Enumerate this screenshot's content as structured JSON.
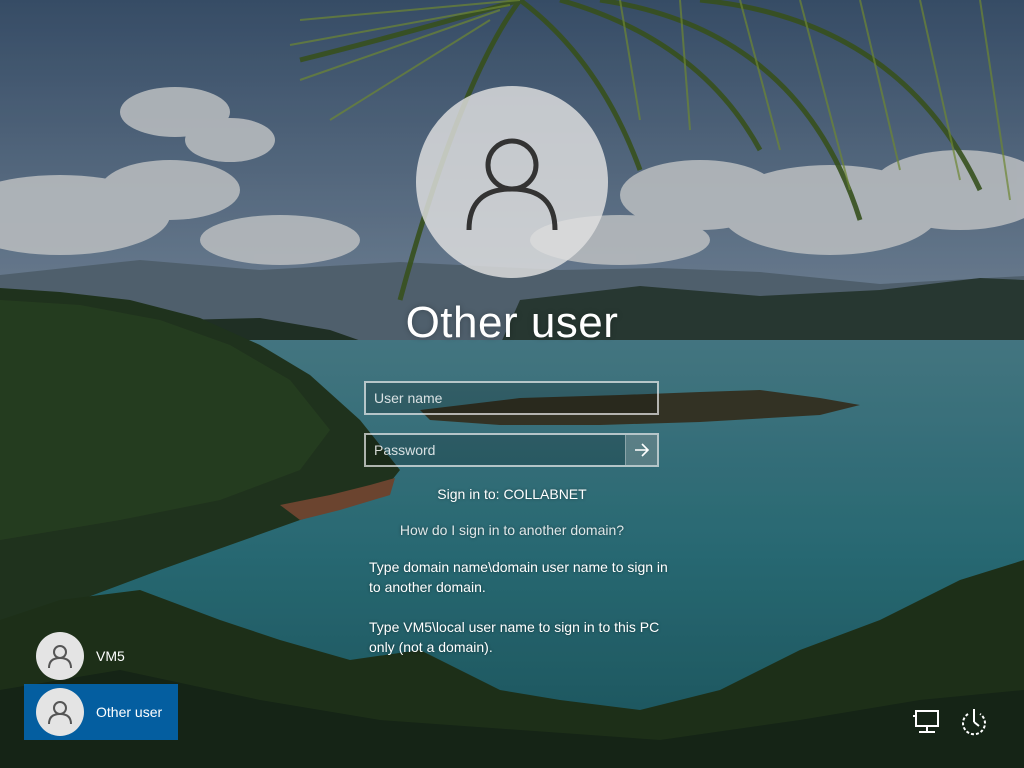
{
  "login": {
    "title": "Other user",
    "username_placeholder": "User name",
    "password_placeholder": "Password",
    "sign_in_to": "Sign in to: COLLABNET",
    "domain_help_link": "How do I sign in to another domain?",
    "help_text_1": "Type domain name\\domain user name to sign in to another domain.",
    "help_text_2": "Type VM5\\local user name to sign in to this PC only (not a domain)."
  },
  "users": [
    {
      "label": "VM5",
      "icon": "person-icon",
      "selected": false
    },
    {
      "label": "Other user",
      "icon": "person-icon",
      "selected": true
    }
  ],
  "system_icons": [
    "network-icon",
    "power-icon"
  ],
  "colors": {
    "selected_tile": "#0078d7"
  }
}
